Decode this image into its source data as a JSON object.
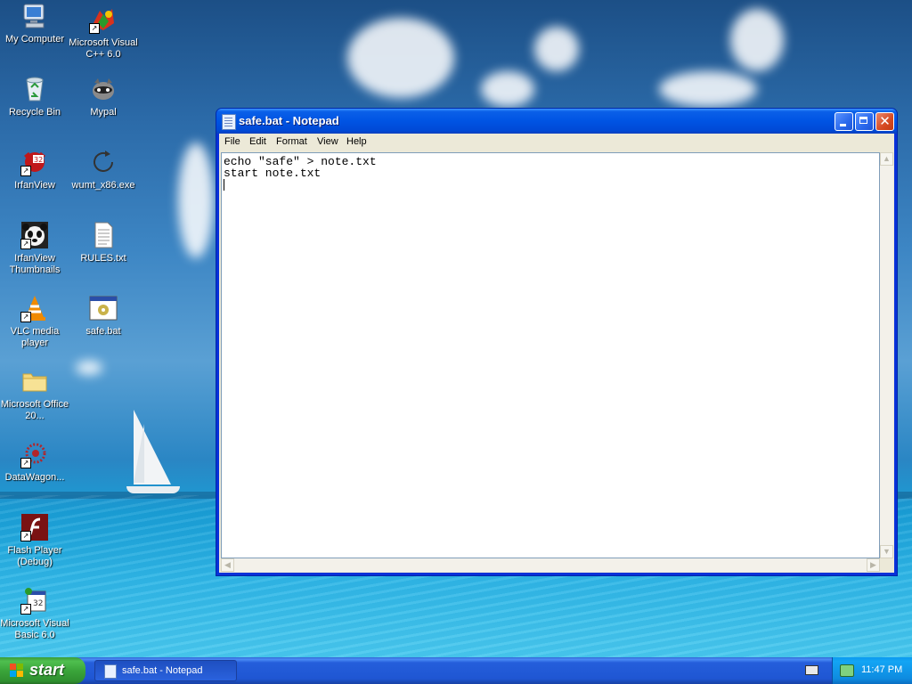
{
  "desktop": {
    "icons": [
      {
        "label": "My Computer",
        "icon": "my-computer-icon"
      },
      {
        "label": "Microsoft Visual C++ 6.0",
        "icon": "visual-cpp-icon"
      },
      {
        "label": "Recycle Bin",
        "icon": "recycle-bin-icon"
      },
      {
        "label": "Mypal",
        "icon": "mypal-icon"
      },
      {
        "label": "IrfanView",
        "icon": "irfanview-icon"
      },
      {
        "label": "wumt_x86.exe",
        "icon": "wumt-icon"
      },
      {
        "label": "IrfanView Thumbnails",
        "icon": "irfanview-thumbnails-icon"
      },
      {
        "label": "RULES.txt",
        "icon": "text-file-icon"
      },
      {
        "label": "VLC media player",
        "icon": "vlc-icon"
      },
      {
        "label": "safe.bat",
        "icon": "batch-file-icon"
      },
      {
        "label": "Microsoft Office 20...",
        "icon": "folder-icon"
      },
      {
        "label": "DataWagon...",
        "icon": "datawagon-icon"
      },
      {
        "label": "Flash Player (Debug)",
        "icon": "flash-player-icon"
      },
      {
        "label": "Microsoft Visual Basic 6.0",
        "icon": "visual-basic-icon"
      }
    ]
  },
  "window": {
    "title": "safe.bat - Notepad",
    "menu": [
      "File",
      "Edit",
      "Format",
      "View",
      "Help"
    ],
    "content": "echo \"safe\" > note.txt\nstart note.txt\n"
  },
  "taskbar": {
    "start_label": "start",
    "task_label": "safe.bat - Notepad",
    "clock": "11:47 PM"
  }
}
